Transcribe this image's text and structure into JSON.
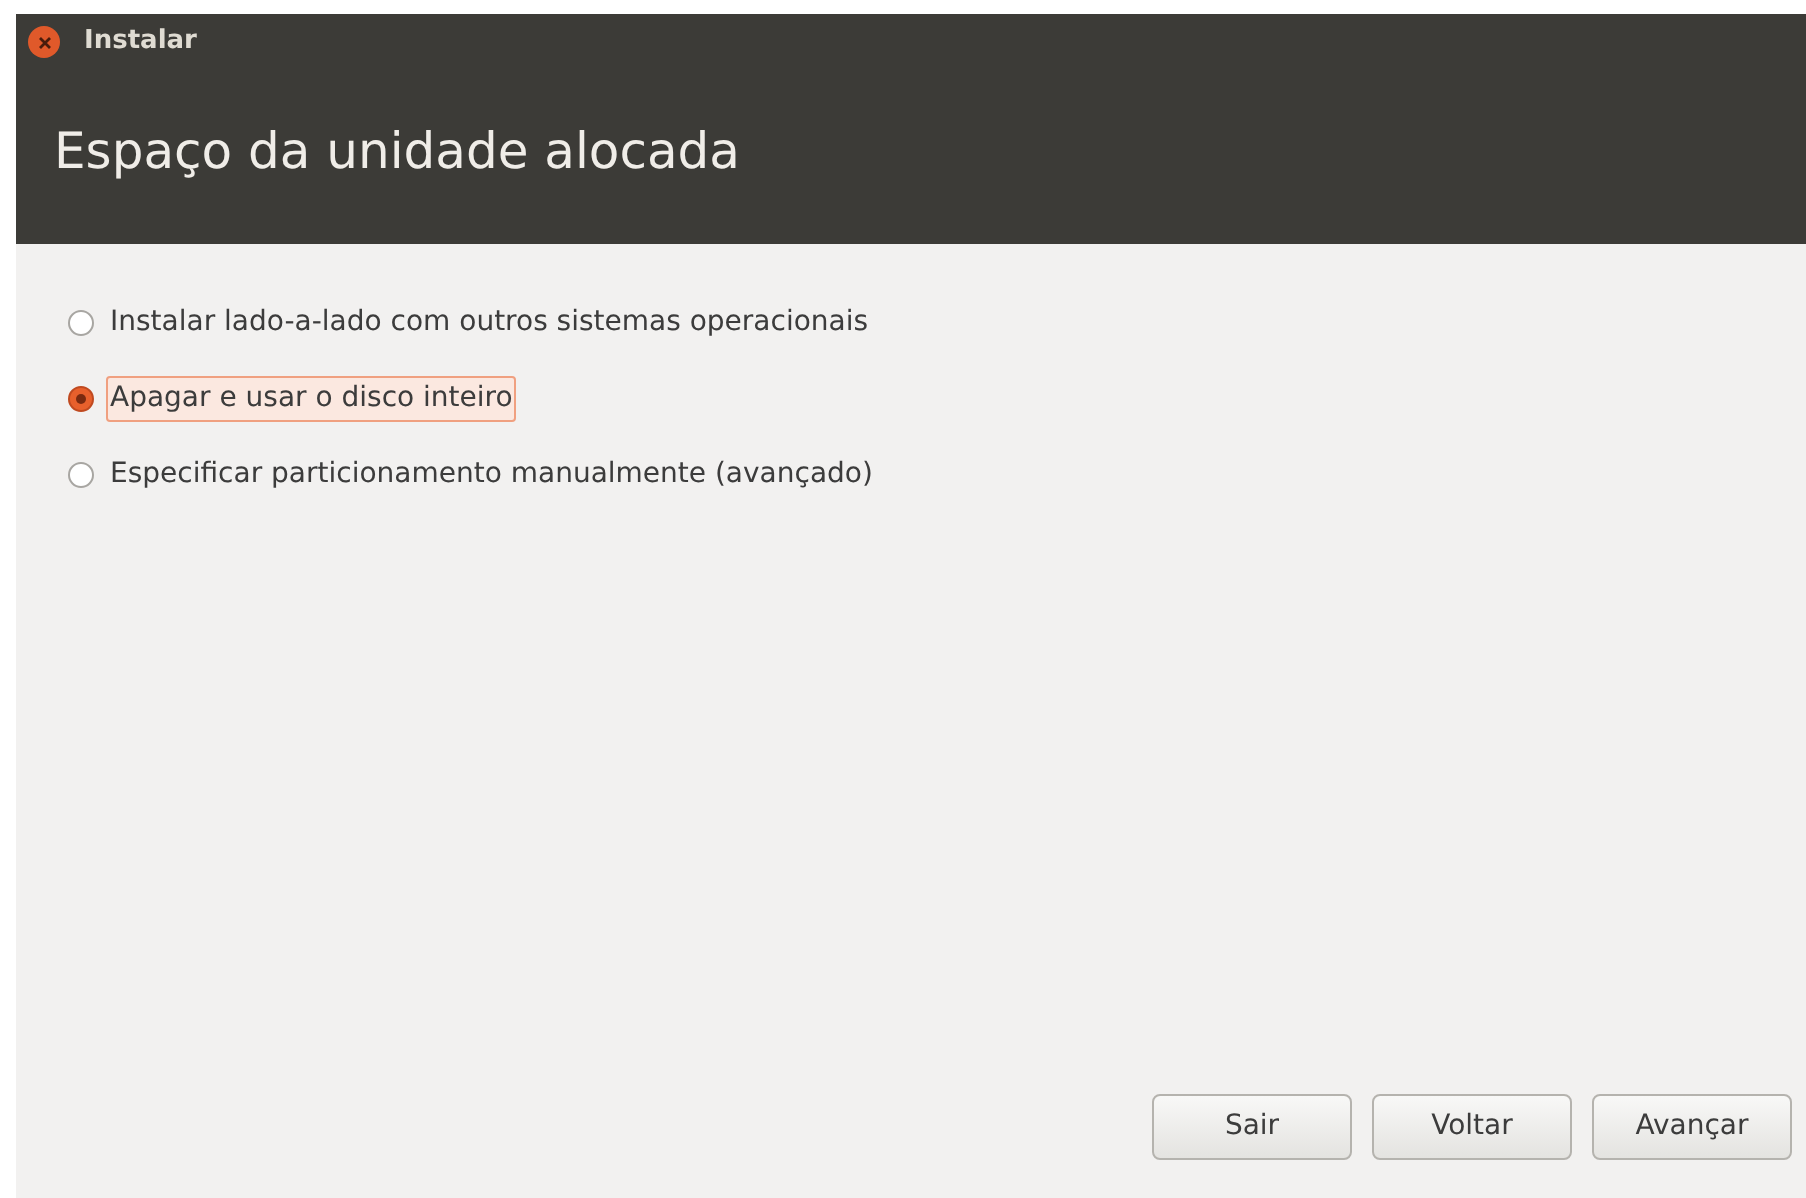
{
  "window": {
    "title": "Instalar"
  },
  "header": {
    "title": "Espaço da unidade alocada"
  },
  "options": [
    {
      "label": "Instalar lado-a-lado com outros sistemas operacionais",
      "selected": false
    },
    {
      "label": "Apagar e usar o disco inteiro",
      "selected": true
    },
    {
      "label": "Especificar particionamento manualmente (avançado)",
      "selected": false
    }
  ],
  "buttons": [
    "Sair",
    "Voltar",
    "Avançar"
  ]
}
